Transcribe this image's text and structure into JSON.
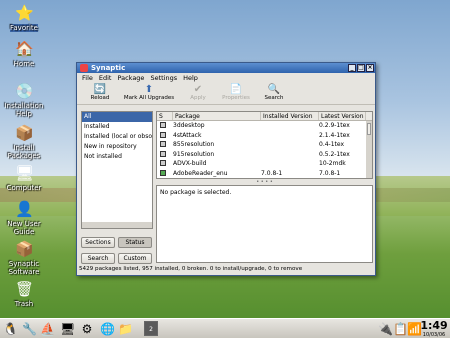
{
  "desktop": {
    "icons": [
      {
        "label": "Favorite",
        "glyph": "⭐"
      },
      {
        "label": "Home",
        "glyph": "🏠"
      },
      {
        "label": "Installation Help",
        "glyph": "💿"
      },
      {
        "label": "Install Packages",
        "glyph": "📦"
      },
      {
        "label": "Computer",
        "glyph": "🖥"
      },
      {
        "label": "New User Guide",
        "glyph": "👤"
      },
      {
        "label": "Synaptic Software",
        "glyph": "📦"
      },
      {
        "label": "Trash",
        "glyph": "🗑"
      }
    ]
  },
  "window": {
    "title": "Synaptic",
    "menu": [
      "File",
      "Edit",
      "Package",
      "Settings",
      "Help"
    ],
    "toolbar": [
      {
        "label": "Reload",
        "icon": "reload-icon",
        "glyph": "🔄",
        "enabled": true
      },
      {
        "label": "Mark All Upgrades",
        "icon": "upgrade-icon",
        "glyph": "⬆",
        "enabled": true
      },
      {
        "label": "Apply",
        "icon": "apply-icon",
        "glyph": "✔",
        "enabled": false
      },
      {
        "label": "Properties",
        "icon": "properties-icon",
        "glyph": "📄",
        "enabled": false
      },
      {
        "label": "Search",
        "icon": "search-icon",
        "glyph": "🔍",
        "enabled": true
      }
    ],
    "filters": [
      "All",
      "Installed",
      "Installed (local or obsolete)",
      "New in repository",
      "Not installed"
    ],
    "buttons": {
      "sections": "Sections",
      "status": "Status",
      "search": "Search",
      "custom": "Custom"
    },
    "table": {
      "headers": {
        "s": "S",
        "package": "Package",
        "installed": "Installed Version",
        "latest": "Latest Version"
      },
      "rows": [
        {
          "package": "3ddesktop",
          "installed": "",
          "latest": "0.2.9-1tex"
        },
        {
          "package": "4stAttack",
          "installed": "",
          "latest": "2.1.4-1tex"
        },
        {
          "package": "855resolution",
          "installed": "",
          "latest": "0.4-1tex"
        },
        {
          "package": "915resolution",
          "installed": "",
          "latest": "0.5.2-1tex"
        },
        {
          "package": "ADVX-build",
          "installed": "",
          "latest": "10-2mdk"
        },
        {
          "package": "AdobeReader_enu",
          "installed": "7.0.8-1",
          "latest": "7.0.8-1"
        }
      ]
    },
    "description": "No package is selected.",
    "status": "5429 packages listed, 957 installed, 0 broken. 0 to install/upgrade, 0 to remove"
  },
  "taskbar": {
    "pager": "2",
    "time": "1:49",
    "date": "10/03/06"
  }
}
